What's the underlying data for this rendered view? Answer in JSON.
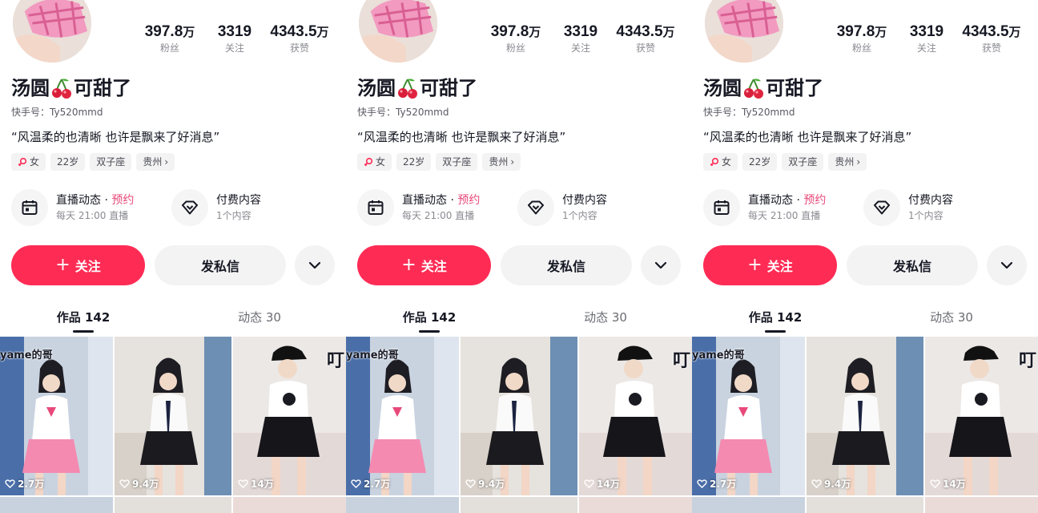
{
  "profile": {
    "nickname": "汤圆",
    "nickname_suffix": "可甜了",
    "uid_label": "快手号：",
    "uid": "Ty520mmd",
    "bio": "“风温柔的也清晰 也许是飘来了好消息”"
  },
  "stats": [
    {
      "value": "397.8",
      "unit": "万",
      "label": "粉丝"
    },
    {
      "value": "3319",
      "unit": "",
      "label": "关注"
    },
    {
      "value": "4343.5",
      "unit": "万",
      "label": "获赞"
    }
  ],
  "tags": [
    {
      "label": "女",
      "icon": "female-icon"
    },
    {
      "label": "22岁"
    },
    {
      "label": "双子座"
    },
    {
      "label": "贵州",
      "chevron": "›"
    }
  ],
  "features": {
    "live": {
      "title": "直播动态 · ",
      "accent": "预约",
      "sub": "每天 21:00 直播",
      "icon": "calendar-icon"
    },
    "paid": {
      "title": "付费内容",
      "sub": "1个内容",
      "icon": "diamond-icon"
    }
  },
  "actions": {
    "follow_plus": "+",
    "follow_label": "关注",
    "message_label": "发私信",
    "more_icon": "chevron-down-icon"
  },
  "tabs": [
    {
      "label": "作品 142",
      "active": true
    },
    {
      "label": "动态 30",
      "active": false
    }
  ],
  "videos": [
    {
      "likes": "2.7万",
      "overlay": "yame的哥"
    },
    {
      "likes": "9.4万",
      "overlay": ""
    },
    {
      "likes": "14万",
      "overlay": "叮"
    }
  ],
  "colors": {
    "accent": "#fe2c55",
    "accent_text": "#e8497a",
    "text": "#161823",
    "muted": "#8a8b91"
  }
}
